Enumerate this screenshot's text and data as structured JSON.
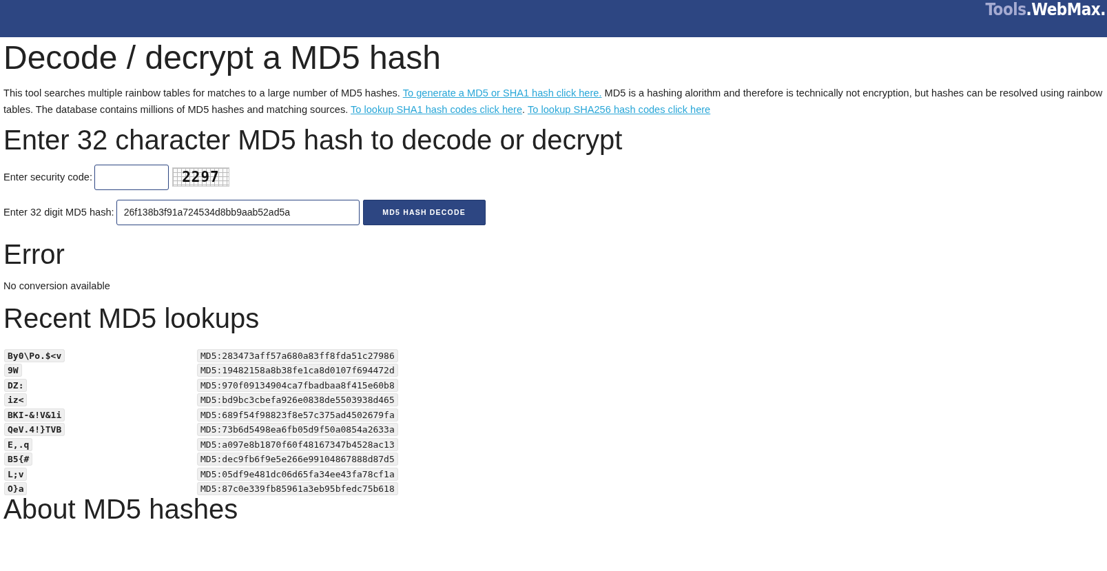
{
  "header": {
    "logo_prefix": "Tools",
    "logo_rest": ".WebMax."
  },
  "title": "Decode / decrypt a MD5 hash",
  "intro": [
    {
      "kind": "text",
      "text": "This tool searches multiple rainbow tables for matches to a large number of MD5 hashes. "
    },
    {
      "kind": "link",
      "text": "To generate a MD5 or SHA1 hash click here."
    },
    {
      "kind": "text",
      "text": " MD5 is a hashing alorithm and therefore is technically not encryption, but hashes can be resolved using rainbow tables. The database contains millions of MD5 hashes and matching sources. "
    },
    {
      "kind": "link",
      "text": "To lookup SHA1 hash codes click here"
    },
    {
      "kind": "text",
      "text": ". "
    },
    {
      "kind": "link",
      "text": "To lookup SHA256 hash codes click here"
    }
  ],
  "form": {
    "heading": "Enter 32 character MD5 hash to decode or decrypt",
    "security_label": "Enter security code:",
    "captcha": "2297",
    "hash_label": "Enter 32 digit MD5 hash:",
    "hash_value": "26f138b3f91a724534d8bb9aab52ad5a",
    "button": "MD5 HASH DECODE"
  },
  "result": {
    "heading": "Error",
    "message": "No conversion available"
  },
  "recent": {
    "heading": "Recent MD5 lookups",
    "rows": [
      {
        "source": "By0\\Po.$<v",
        "hash": "MD5:283473aff57a680a83ff8fda51c27986"
      },
      {
        "source": "9W",
        "hash": "MD5:19482158a8b38fe1ca8d0107f694472d"
      },
      {
        "source": "DZ:",
        "hash": "MD5:970f09134904ca7fbadbaa8f415e60b8"
      },
      {
        "source": "iz<",
        "hash": "MD5:bd9bc3cbefa926e0838de5503938d465"
      },
      {
        "source": "BKI-&!V&1i",
        "hash": "MD5:689f54f98823f8e57c375ad4502679fa"
      },
      {
        "source": "QeV.4!}TVB",
        "hash": "MD5:73b6d5498ea6fb05d9f50a0854a2633a"
      },
      {
        "source": "E,.q",
        "hash": "MD5:a097e8b1870f60f48167347b4528ac13"
      },
      {
        "source": "B5{#",
        "hash": "MD5:dec9fb6f9e5e266e99104867888d87d5"
      },
      {
        "source": "L;v",
        "hash": "MD5:05df9e481dc06d65fa34ee43fa78cf1a"
      },
      {
        "source": "O}a",
        "hash": "MD5:87c0e339fb85961a3eb95bfedc75b618"
      }
    ]
  },
  "about": {
    "heading": "About MD5 hashes"
  }
}
